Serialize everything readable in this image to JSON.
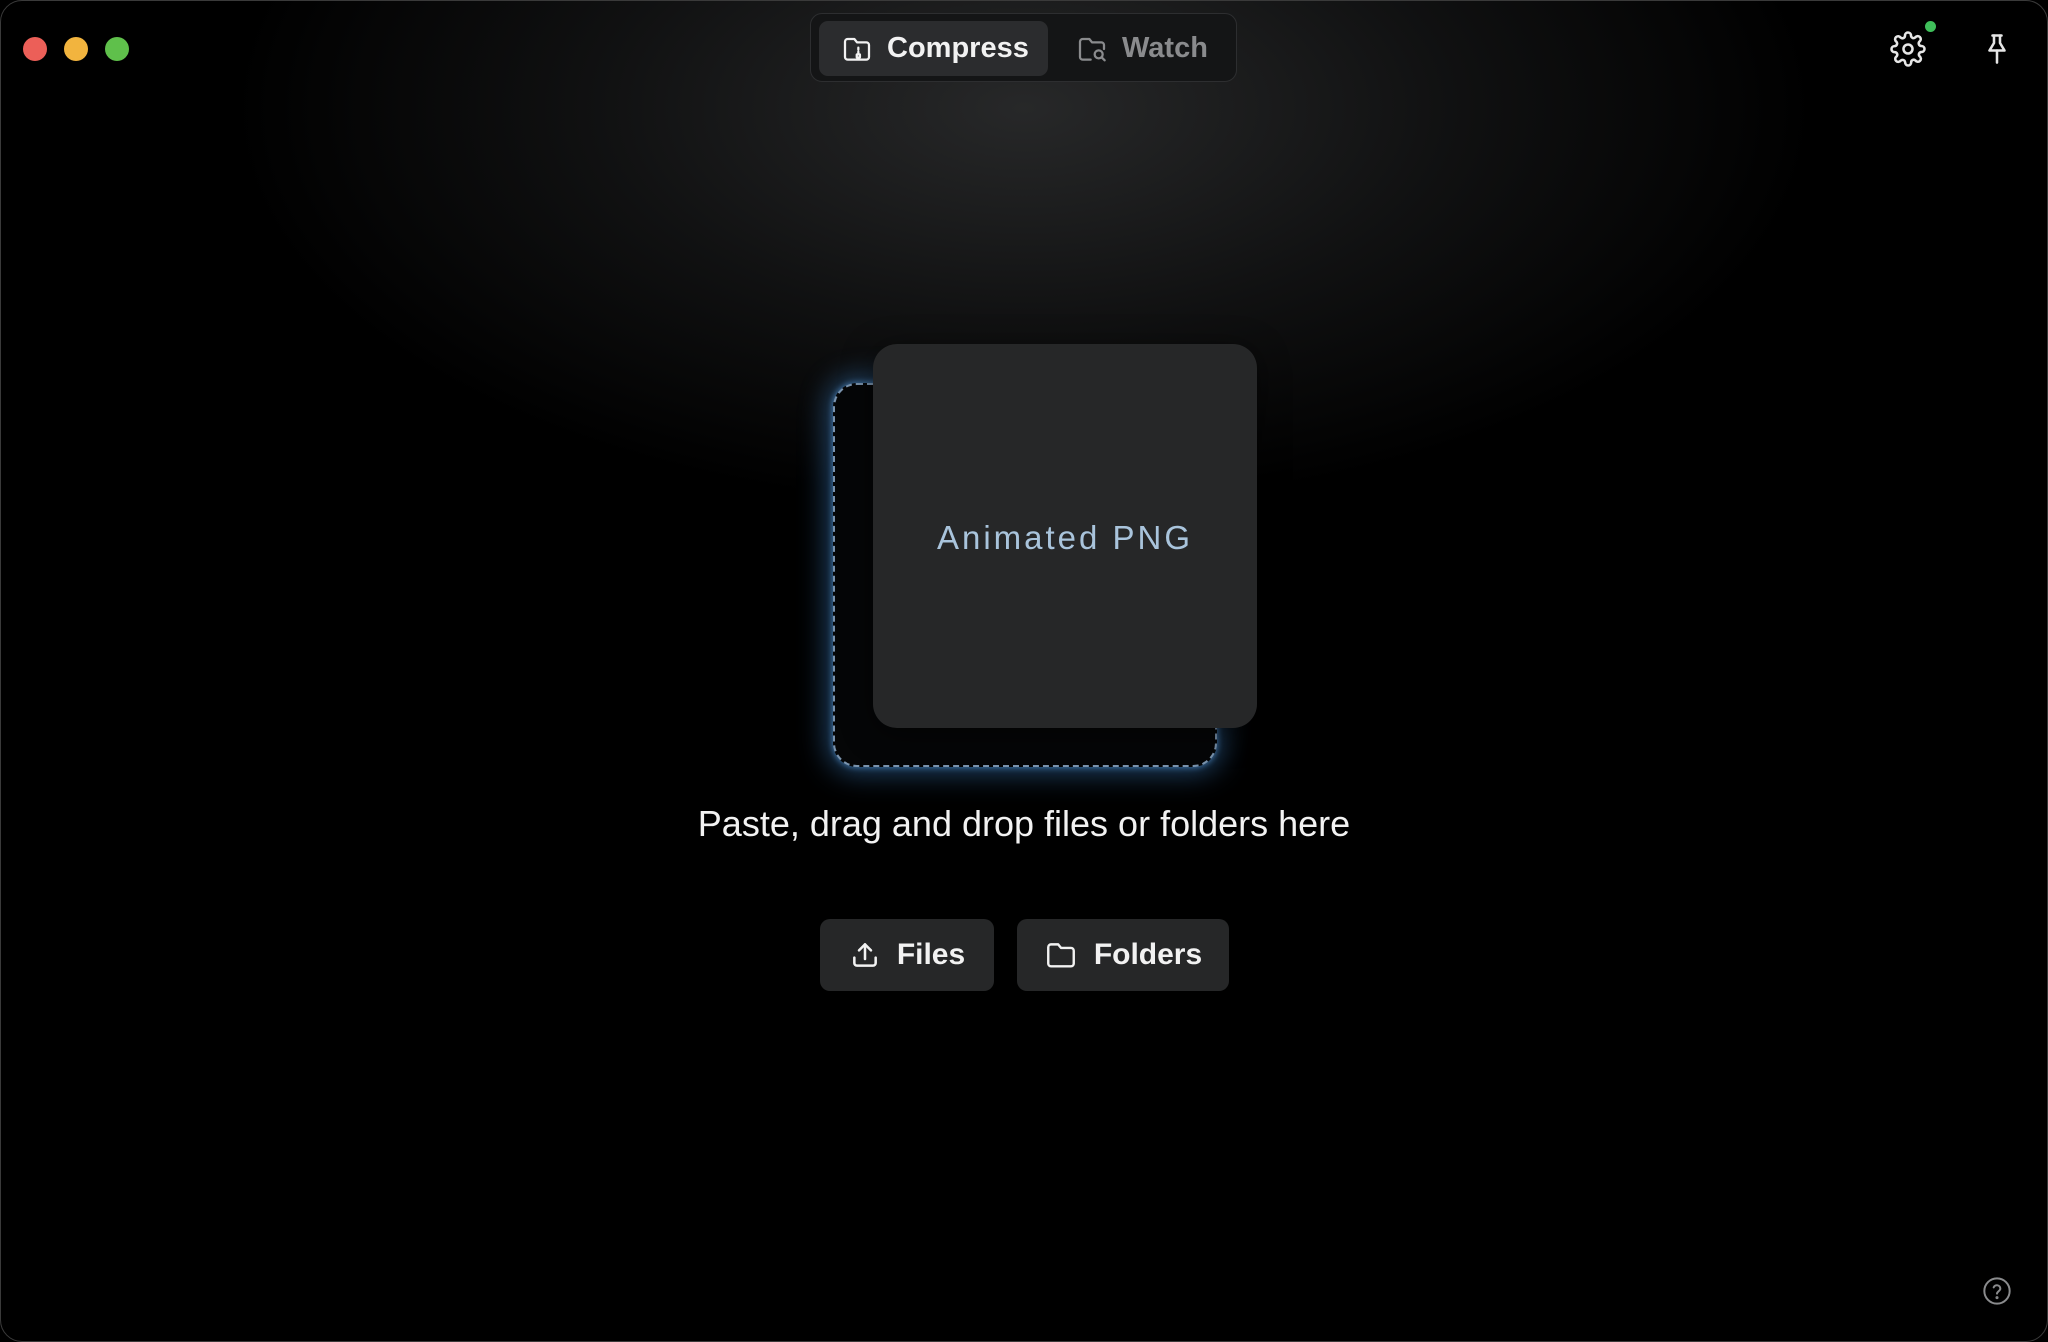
{
  "window": {
    "traffic_lights": [
      "close",
      "minimize",
      "maximize"
    ]
  },
  "tabs": [
    {
      "label": "Compress",
      "icon": "folder-compress-icon",
      "active": true
    },
    {
      "label": "Watch",
      "icon": "folder-search-icon",
      "active": false
    }
  ],
  "toolbar": {
    "settings_icon": "gear-icon",
    "settings_notification": true,
    "pin_icon": "pin-icon"
  },
  "drop_area": {
    "format_label": "Animated PNG",
    "hint": "Paste, drag and drop files or folders here"
  },
  "actions": {
    "files_label": "Files",
    "folders_label": "Folders"
  },
  "footer": {
    "help_icon": "help-icon"
  },
  "colors": {
    "accent_glow": "#4896e6",
    "notification": "#3fbf5a"
  }
}
